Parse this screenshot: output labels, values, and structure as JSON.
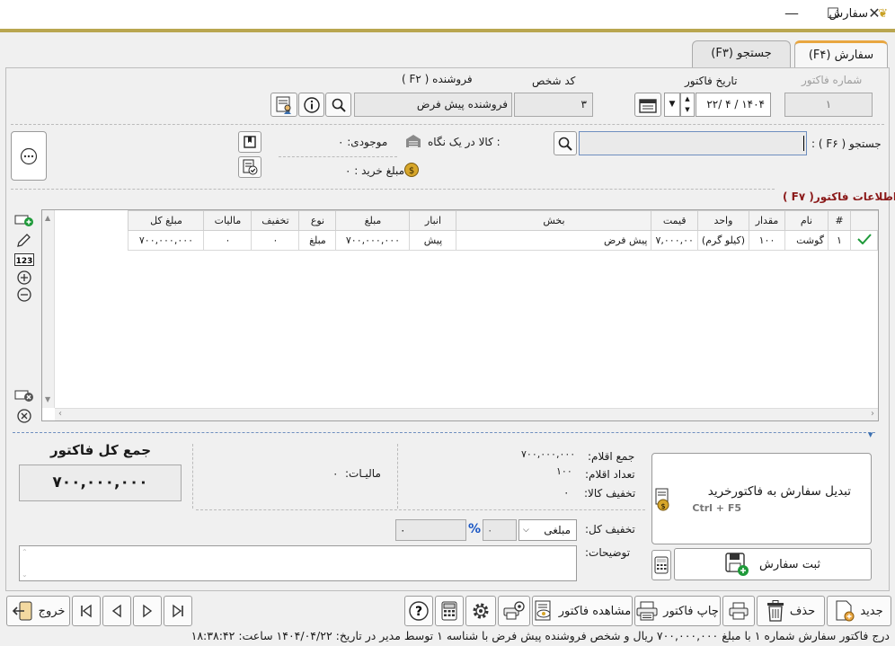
{
  "window": {
    "title": "سفارش",
    "minimize": "—",
    "maximize": "☐",
    "close": "✕"
  },
  "tabs": [
    {
      "label": "سفارش (F۴)",
      "active": true
    },
    {
      "label": "جستجو (F۳)",
      "active": false
    }
  ],
  "header": {
    "invoice_number_label": "شماره فاکتور",
    "invoice_number_value": "۱",
    "invoice_date_label": "تاریخ فاکتور",
    "invoice_date_value": "۱۴۰۴ / ۴ /۲۲",
    "person_code_label": "کد شخص",
    "person_code_value": "۳",
    "seller_label": "فروشنده ( F۲ )",
    "seller_value": "فروشنده پیش فرض"
  },
  "search": {
    "label": "جستجو ( F۶ ) :",
    "value": "",
    "goods_at_glance_label": ": کالا در یک نگاه",
    "stock_label": "موجودی: ۰",
    "purchase_amount_label": "مبلغ خرید : ۰"
  },
  "invoice_info": {
    "title": "اطلاعات فاکتور( F۷ )",
    "columns": [
      "#",
      "نام",
      "مقدار",
      "واحد",
      "قیمت",
      "بخش",
      "انبار",
      "مبلغ",
      "نوع",
      "تخفیف",
      "مالیات",
      "مبلغ کل"
    ],
    "rows": [
      [
        "۱",
        "گوشت",
        "۱۰۰",
        "(کیلو گرم)",
        "۷,۰۰۰,۰۰",
        "پیش فرض",
        "پیش",
        "۷۰۰,۰۰۰,۰۰۰",
        "مبلغ",
        "۰",
        "۰",
        "۷۰۰,۰۰۰,۰۰۰"
      ]
    ]
  },
  "summary": {
    "total_title": "جمع کل فاکتور",
    "total_value": "۷۰۰,۰۰۰,۰۰۰",
    "tax_label": "مالیـات:",
    "tax_value": "۰",
    "items_sum_label": "جمع اقلام:",
    "items_sum_value": "۷۰۰,۰۰۰,۰۰۰",
    "items_count_label": "تعداد اقلام:",
    "items_count_value": "۱۰۰",
    "goods_discount_label": "تخفیف کالا:",
    "goods_discount_value": "۰",
    "total_discount_label": "تخفیف کل:",
    "discount_type": "مبلغی",
    "discount_amount": "۰",
    "discount_percent": "۰",
    "percent_sign": "%",
    "notes_label": "توضیحات:",
    "notes_value": ""
  },
  "actions": {
    "convert_label": "تبدیل سفارش به فاکتورخرید",
    "convert_shortcut": "Ctrl + F5",
    "save_order_label": "ثبت  سفارش"
  },
  "toolbar": {
    "new_label": "جدید",
    "delete_label": "حذف",
    "print_label": "چاپ فاکتور",
    "view_label": "مشاهده فاکتور",
    "exit_label": "خروج"
  },
  "status": "درج فاکتور سفارش شماره ۱ با مبلغ ۷۰۰,۰۰۰,۰۰۰ ریال و شخص فروشنده پیش فرض با شناسه ۱ توسط مدیر در تاریخ: ۱۴۰۴/۰۴/۲۲ ساعت: ۱۸:۳۸:۴۲",
  "colors": {
    "accent": "#e8a640",
    "gold_line": "#b9a650",
    "check_green": "#1f9a3a",
    "title_red": "#8b1a1a",
    "percent_blue": "#1a56c4"
  }
}
